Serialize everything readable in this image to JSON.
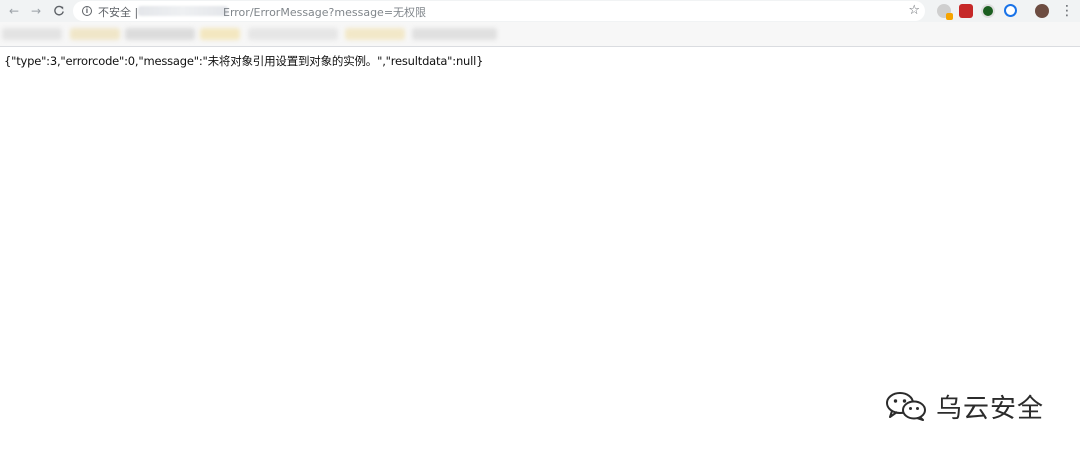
{
  "browser": {
    "nav": {
      "back_icon": "←",
      "forward_icon": "→",
      "reload_icon": "C"
    },
    "omnibox": {
      "security_label": "不安全 |",
      "url_path": "Error/ErrorMessage?message=无权限"
    },
    "star_icon": "☆",
    "menu_icon": "⋮",
    "extensions": [
      {
        "name": "ext-icon-1",
        "color": "#c8c8c8"
      },
      {
        "name": "ext-icon-2",
        "color": "#d32f2f"
      },
      {
        "name": "ext-icon-3",
        "color": "#2e7d32"
      },
      {
        "name": "ext-icon-4",
        "color": "#1a73e8"
      },
      {
        "name": "profile-avatar",
        "color": "#6d4c41"
      }
    ]
  },
  "page": {
    "body_text": "{\"type\":3,\"errorcode\":0,\"message\":\"未将对象引用设置到对象的实例。\",\"resultdata\":null}"
  },
  "watermark": {
    "text": "乌云安全"
  }
}
